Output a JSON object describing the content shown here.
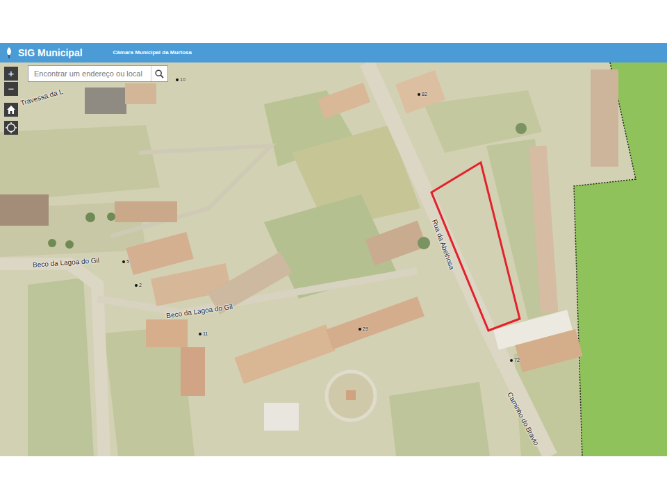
{
  "header": {
    "app_title": "SIG Municipal",
    "subtitle": "Câmara Municipal da Murtosa"
  },
  "zoom_controls": [
    {
      "label": "+"
    },
    {
      "label": "−"
    }
  ],
  "search": {
    "placeholder": "Encontrar um endereço ou local"
  },
  "streets": [
    {
      "label": "Travessa da L"
    },
    {
      "label": "Beco da Lagoa do Gil"
    },
    {
      "label": "Beco da Lagoa do Gil"
    },
    {
      "label": "Rua da Abelhosa"
    },
    {
      "label": "Caminho do Bravio"
    }
  ],
  "house_numbers": [
    "10",
    "82",
    "5",
    "2",
    "11",
    "29",
    "72"
  ],
  "parcel": {
    "highlighted": true
  }
}
